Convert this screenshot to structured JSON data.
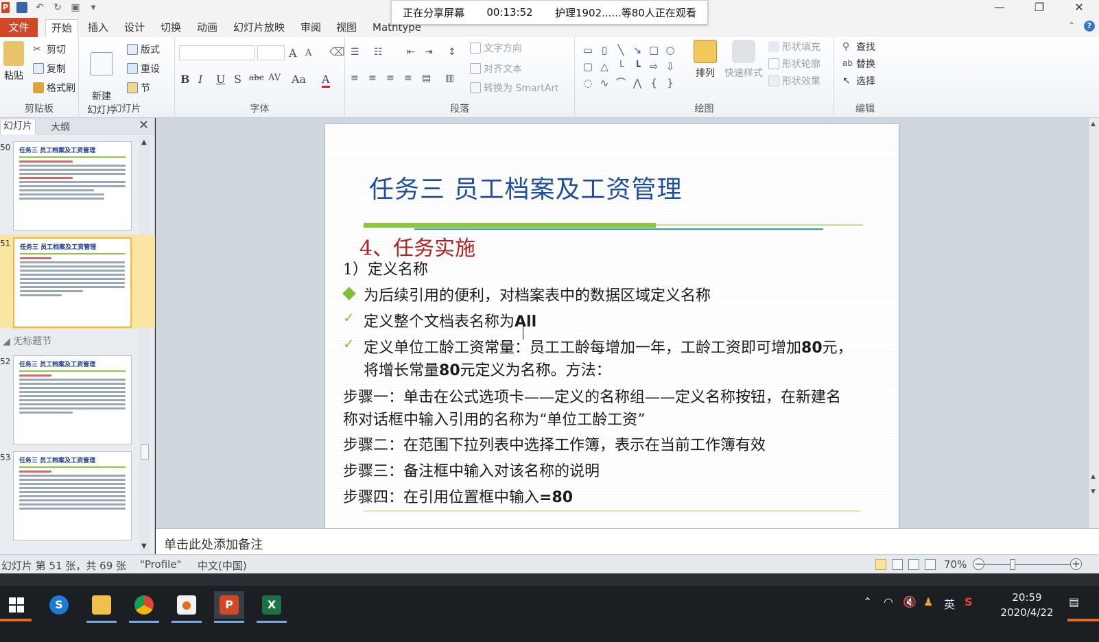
{
  "quick_access": {
    "icons": [
      "powerpoint-logo",
      "save-icon",
      "undo-icon",
      "redo-icon",
      "start-slideshow-icon",
      "customize-qat-icon"
    ]
  },
  "share_banner": {
    "status": "正在分享屏幕",
    "timer": "00:13:52",
    "viewers": "护理1902......等80人正在观看"
  },
  "window_controls": {
    "minimize": "—",
    "restore": "❐",
    "close": "✕"
  },
  "menu": {
    "file": "文件",
    "tabs": [
      "开始",
      "插入",
      "设计",
      "切换",
      "动画",
      "幻灯片放映",
      "审阅",
      "视图",
      "Mathtype"
    ]
  },
  "ribbon": {
    "clipboard": {
      "label": "剪贴板",
      "paste": "粘贴",
      "cut": "剪切",
      "copy": "复制",
      "format_painter": "格式刷"
    },
    "slides": {
      "label": "幻灯片",
      "new_slide": "新建\n幻灯片",
      "layout": "版式",
      "reset": "重设",
      "section": "节"
    },
    "font": {
      "label": "字体",
      "bold": "B",
      "italic": "I",
      "underline": "U",
      "shadow": "S",
      "strike": "abc",
      "spacing": "AV",
      "case": "Aa",
      "color": "A",
      "grow": "A",
      "shrink": "A"
    },
    "paragraph": {
      "label": "段落",
      "text_direction": "文字方向",
      "align_text": "对齐文本",
      "convert_smartart": "转换为 SmartArt"
    },
    "drawing": {
      "label": "绘图",
      "arrange": "排列",
      "quick_styles": "快速样式",
      "shape_fill": "形状填充",
      "shape_outline": "形状轮廓",
      "shape_effects": "形状效果"
    },
    "editing": {
      "label": "编辑",
      "find": "查找",
      "replace": "替换",
      "select": "选择"
    }
  },
  "left_panel": {
    "tabs": [
      "幻灯片",
      "大纲"
    ],
    "close": "✕",
    "section_title": "无标题节",
    "thumbnails": [
      {
        "num": "50",
        "title": "任务三  员工档案及工资管理"
      },
      {
        "num": "51",
        "title": "任务三  员工档案及工资管理"
      },
      {
        "num": "52",
        "title": "任务三  员工档案及工资管理"
      },
      {
        "num": "53",
        "title": "任务三  员工档案及工资管理"
      }
    ]
  },
  "slide": {
    "title": "任务三    员工档案及工资管理",
    "section": "4、任务实施",
    "subheading": "1）定义名称",
    "bullet1": "为后续引用的便利，对档案表中的数据区域定义名称",
    "check1_prefix": "定义整个文档表名称为",
    "check1_bold": "All",
    "check2_a": "定义单位工龄工资常量：员工工龄每增加一年，工龄工资即可增加",
    "check2_bold1": "80",
    "check2_b": "元，",
    "check2_c": "将增长常量",
    "check2_bold2": "80",
    "check2_d": "元定义为名称。方法：",
    "step1_a": "步骤一：单击在公式选项卡——定义的名称组——定义名称按钮，在新建名",
    "step1_b": "称对话框中输入引用的名称为“单位工龄工资”",
    "step2": "步骤二：在范围下拉列表中选择工作簿，表示在当前工作簿有效",
    "step3": "步骤三：备注框中输入对该名称的说明",
    "step4_prefix": "步骤四：在引用位置框中输入",
    "step4_bold": "=80"
  },
  "notes": {
    "placeholder": "单击此处添加备注"
  },
  "status": {
    "slide_info": "幻灯片 第 51 张，共 69 张",
    "theme": "\"Profile\"",
    "language": "中文(中国)",
    "zoom": "70%"
  },
  "taskbar": {
    "apps": [
      "windows-start",
      "sogou-browser",
      "file-explorer",
      "chrome",
      "recording-app",
      "powerpoint",
      "excel"
    ],
    "tray": {
      "ime": "英",
      "time": "20:59",
      "date": "2020/4/22"
    }
  }
}
